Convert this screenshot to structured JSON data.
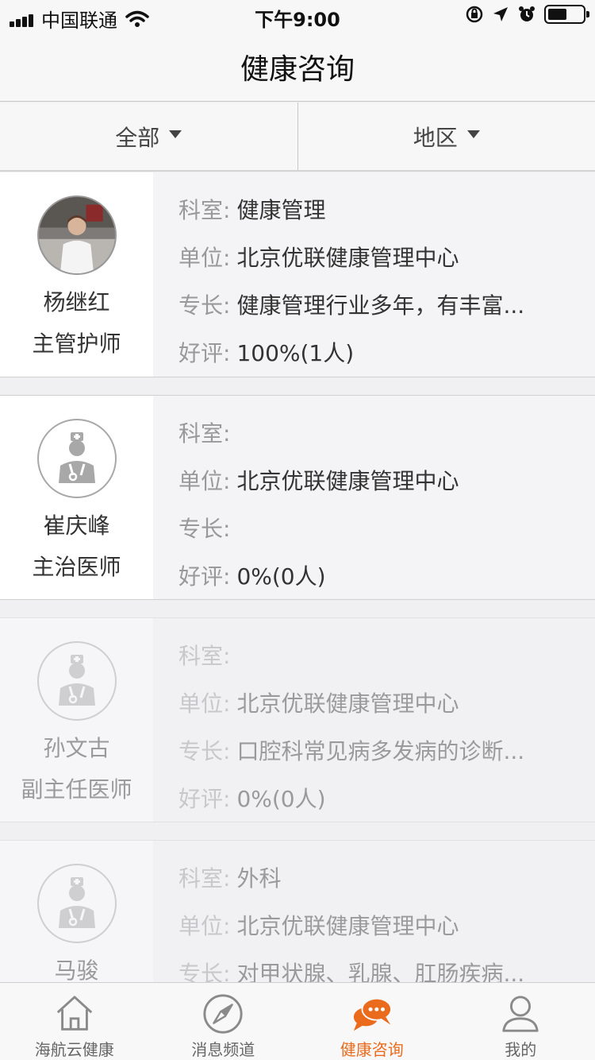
{
  "status_bar": {
    "carrier": "中国联通",
    "time": "下午9:00",
    "battery_level": 0.55
  },
  "nav": {
    "title": "健康咨询"
  },
  "filters": [
    {
      "label": "全部"
    },
    {
      "label": "地区"
    }
  ],
  "labels": {
    "department": "科室:",
    "unit": "单位:",
    "specialty": "专长:",
    "rating": "好评:"
  },
  "doctors": [
    {
      "name": "杨继红",
      "title": "主管护师",
      "avatar": "photo",
      "department": "健康管理",
      "unit": "北京优联健康管理中心",
      "specialty": "健康管理行业多年，有丰富...",
      "rating": "100%(1人)"
    },
    {
      "name": "崔庆峰",
      "title": "主治医师",
      "avatar": "doctor-placeholder-icon",
      "department": "",
      "unit": "北京优联健康管理中心",
      "specialty": "",
      "rating": "0%(0人)"
    },
    {
      "name": "孙文古",
      "title": "副主任医师",
      "avatar": "doctor-placeholder-icon",
      "department": "",
      "unit": "北京优联健康管理中心",
      "specialty": "口腔科常见病多发病的诊断...",
      "rating": "0%(0人)"
    },
    {
      "name": "马骏",
      "title": "",
      "avatar": "doctor-placeholder-icon",
      "department": "外科",
      "unit": "北京优联健康管理中心",
      "specialty": "对甲状腺、乳腺、肛肠疾病...",
      "rating": ""
    }
  ],
  "tabs": [
    {
      "label": "海航云健康",
      "icon": "home-icon",
      "active": false
    },
    {
      "label": "消息频道",
      "icon": "compass-icon",
      "active": false
    },
    {
      "label": "健康咨询",
      "icon": "chat-bubble-icon",
      "active": true
    },
    {
      "label": "我的",
      "icon": "person-icon",
      "active": false
    }
  ],
  "colors": {
    "accent": "#ea6b1b",
    "label_gray": "#999999",
    "background": "#f0f0f3"
  }
}
